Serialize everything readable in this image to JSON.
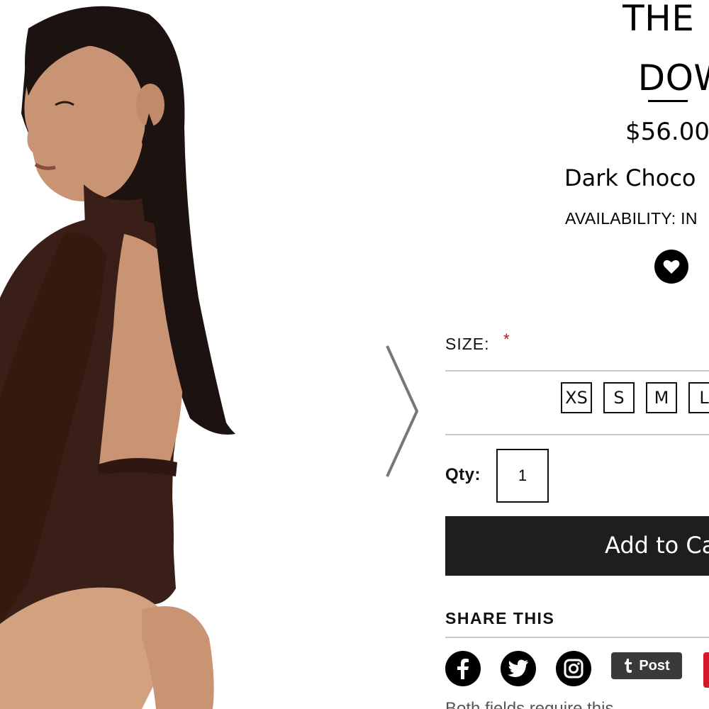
{
  "product": {
    "title_lines": [
      "THE NW HO",
      "DOWN BO"
    ],
    "price": "$56.00",
    "color": "Dark Choco",
    "availability": "AVAILABILITY: IN"
  },
  "size": {
    "label": "SIZE:",
    "required_mark": "*",
    "options": [
      "XS",
      "S",
      "M",
      "L"
    ]
  },
  "quantity": {
    "label": "Qty:",
    "value": "1"
  },
  "cart": {
    "add_label": "Add to Ca"
  },
  "share": {
    "label": "SHARE THIS",
    "networks": [
      "facebook-icon",
      "twitter-icon",
      "instagram-icon",
      "tumblr-icon",
      "pinterest-icon"
    ],
    "tumblr_label": "Post"
  },
  "footnote": "Both fields require this",
  "colors": {
    "button": "#1e1e1e",
    "required": "#c0121a",
    "bodysuit": "#3a1f18",
    "hair": "#1c1310"
  }
}
